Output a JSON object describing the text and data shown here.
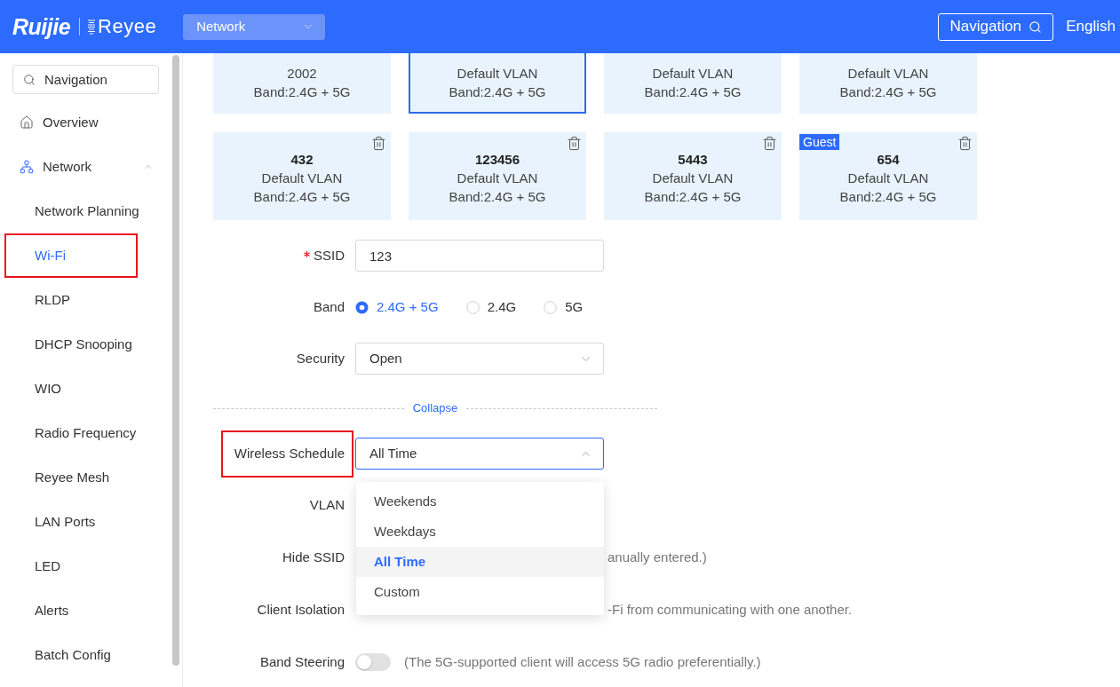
{
  "header": {
    "logo": {
      "brand": "Ruijie",
      "sub_brand": "Reyee"
    },
    "section_select": {
      "value": "Network"
    },
    "navigation_button": "Navigation",
    "language": "English"
  },
  "sidebar": {
    "search": {
      "placeholder": "Navigation"
    },
    "items": [
      {
        "label": "Overview",
        "active": false
      },
      {
        "label": "Network",
        "active": true,
        "expanded": true,
        "children": [
          {
            "label": "Network Planning",
            "selected": false,
            "highlighted": false
          },
          {
            "label": "Wi-Fi",
            "selected": true,
            "highlighted": true
          },
          {
            "label": "RLDP",
            "selected": false,
            "highlighted": false
          },
          {
            "label": "DHCP Snooping",
            "selected": false,
            "highlighted": false
          },
          {
            "label": "WIO",
            "selected": false,
            "highlighted": false
          },
          {
            "label": "Radio Frequency",
            "selected": false,
            "highlighted": false
          },
          {
            "label": "Reyee Mesh",
            "selected": false,
            "highlighted": false
          },
          {
            "label": "LAN Ports",
            "selected": false,
            "highlighted": false
          },
          {
            "label": "LED",
            "selected": false,
            "highlighted": false
          },
          {
            "label": "Alerts",
            "selected": false,
            "highlighted": false
          },
          {
            "label": "Batch Config",
            "selected": false,
            "highlighted": false
          }
        ]
      }
    ]
  },
  "ssid_cards": [
    {
      "vlan": "2002",
      "band": "Band:2.4G + 5G",
      "selected": false
    },
    {
      "vlan": "Default VLAN",
      "band": "Band:2.4G + 5G",
      "selected": true
    },
    {
      "vlan": "Default VLAN",
      "band": "Band:2.4G + 5G",
      "selected": false
    },
    {
      "vlan": "Default VLAN",
      "band": "Band:2.4G + 5G",
      "selected": false
    },
    {
      "title": "432",
      "vlan": "Default VLAN",
      "band": "Band:2.4G + 5G",
      "selected": false,
      "deletable": true
    },
    {
      "title": "123456",
      "vlan": "Default VLAN",
      "band": "Band:2.4G + 5G",
      "selected": false,
      "deletable": true
    },
    {
      "title": "5443",
      "vlan": "Default VLAN",
      "band": "Band:2.4G + 5G",
      "selected": false,
      "deletable": true
    },
    {
      "badge": "Guest",
      "title": "654",
      "vlan": "Default VLAN",
      "band": "Band:2.4G + 5G",
      "selected": false,
      "deletable": true
    }
  ],
  "form": {
    "fields": [
      {
        "kind": "text",
        "label": "SSID",
        "required": true,
        "value": "123"
      },
      {
        "kind": "radio",
        "label": "Band",
        "options": [
          {
            "label": "2.4G + 5G",
            "selected": true
          },
          {
            "label": "2.4G",
            "selected": false
          },
          {
            "label": "5G",
            "selected": false
          }
        ]
      },
      {
        "kind": "select",
        "label": "Security",
        "value": "Open",
        "expanded": false
      }
    ],
    "collapse_link": "Collapse",
    "advanced_fields": [
      {
        "kind": "select",
        "label": "Wireless Schedule",
        "value": "All Time",
        "expanded": true,
        "highlighted": true,
        "options": [
          {
            "label": "Weekends",
            "selected": false
          },
          {
            "label": "Weekdays",
            "selected": false
          },
          {
            "label": "All Time",
            "selected": true
          },
          {
            "label": "Custom",
            "selected": false
          }
        ]
      },
      {
        "kind": "covered",
        "label": "VLAN"
      },
      {
        "kind": "covered",
        "label": "Hide SSID",
        "hint": "anually entered.)"
      },
      {
        "kind": "covered",
        "label": "Client Isolation",
        "hint": "-Fi from communicating with one another."
      },
      {
        "kind": "toggle",
        "label": "Band Steering",
        "on": false,
        "hint": "(The 5G-supported client will access 5G radio preferentially.)"
      }
    ]
  }
}
